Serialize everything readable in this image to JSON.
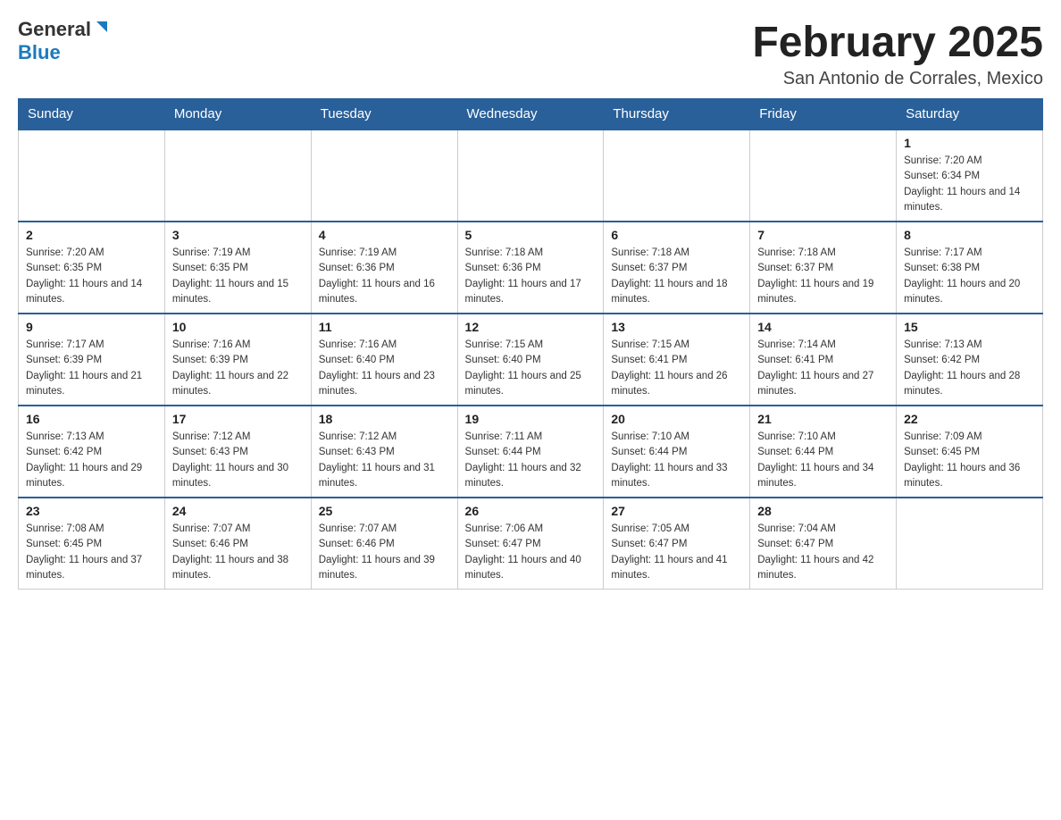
{
  "header": {
    "logo_general": "General",
    "logo_blue": "Blue",
    "title": "February 2025",
    "location": "San Antonio de Corrales, Mexico"
  },
  "weekdays": [
    "Sunday",
    "Monday",
    "Tuesday",
    "Wednesday",
    "Thursday",
    "Friday",
    "Saturday"
  ],
  "weeks": [
    [
      {
        "day": "",
        "info": ""
      },
      {
        "day": "",
        "info": ""
      },
      {
        "day": "",
        "info": ""
      },
      {
        "day": "",
        "info": ""
      },
      {
        "day": "",
        "info": ""
      },
      {
        "day": "",
        "info": ""
      },
      {
        "day": "1",
        "info": "Sunrise: 7:20 AM\nSunset: 6:34 PM\nDaylight: 11 hours and 14 minutes."
      }
    ],
    [
      {
        "day": "2",
        "info": "Sunrise: 7:20 AM\nSunset: 6:35 PM\nDaylight: 11 hours and 14 minutes."
      },
      {
        "day": "3",
        "info": "Sunrise: 7:19 AM\nSunset: 6:35 PM\nDaylight: 11 hours and 15 minutes."
      },
      {
        "day": "4",
        "info": "Sunrise: 7:19 AM\nSunset: 6:36 PM\nDaylight: 11 hours and 16 minutes."
      },
      {
        "day": "5",
        "info": "Sunrise: 7:18 AM\nSunset: 6:36 PM\nDaylight: 11 hours and 17 minutes."
      },
      {
        "day": "6",
        "info": "Sunrise: 7:18 AM\nSunset: 6:37 PM\nDaylight: 11 hours and 18 minutes."
      },
      {
        "day": "7",
        "info": "Sunrise: 7:18 AM\nSunset: 6:37 PM\nDaylight: 11 hours and 19 minutes."
      },
      {
        "day": "8",
        "info": "Sunrise: 7:17 AM\nSunset: 6:38 PM\nDaylight: 11 hours and 20 minutes."
      }
    ],
    [
      {
        "day": "9",
        "info": "Sunrise: 7:17 AM\nSunset: 6:39 PM\nDaylight: 11 hours and 21 minutes."
      },
      {
        "day": "10",
        "info": "Sunrise: 7:16 AM\nSunset: 6:39 PM\nDaylight: 11 hours and 22 minutes."
      },
      {
        "day": "11",
        "info": "Sunrise: 7:16 AM\nSunset: 6:40 PM\nDaylight: 11 hours and 23 minutes."
      },
      {
        "day": "12",
        "info": "Sunrise: 7:15 AM\nSunset: 6:40 PM\nDaylight: 11 hours and 25 minutes."
      },
      {
        "day": "13",
        "info": "Sunrise: 7:15 AM\nSunset: 6:41 PM\nDaylight: 11 hours and 26 minutes."
      },
      {
        "day": "14",
        "info": "Sunrise: 7:14 AM\nSunset: 6:41 PM\nDaylight: 11 hours and 27 minutes."
      },
      {
        "day": "15",
        "info": "Sunrise: 7:13 AM\nSunset: 6:42 PM\nDaylight: 11 hours and 28 minutes."
      }
    ],
    [
      {
        "day": "16",
        "info": "Sunrise: 7:13 AM\nSunset: 6:42 PM\nDaylight: 11 hours and 29 minutes."
      },
      {
        "day": "17",
        "info": "Sunrise: 7:12 AM\nSunset: 6:43 PM\nDaylight: 11 hours and 30 minutes."
      },
      {
        "day": "18",
        "info": "Sunrise: 7:12 AM\nSunset: 6:43 PM\nDaylight: 11 hours and 31 minutes."
      },
      {
        "day": "19",
        "info": "Sunrise: 7:11 AM\nSunset: 6:44 PM\nDaylight: 11 hours and 32 minutes."
      },
      {
        "day": "20",
        "info": "Sunrise: 7:10 AM\nSunset: 6:44 PM\nDaylight: 11 hours and 33 minutes."
      },
      {
        "day": "21",
        "info": "Sunrise: 7:10 AM\nSunset: 6:44 PM\nDaylight: 11 hours and 34 minutes."
      },
      {
        "day": "22",
        "info": "Sunrise: 7:09 AM\nSunset: 6:45 PM\nDaylight: 11 hours and 36 minutes."
      }
    ],
    [
      {
        "day": "23",
        "info": "Sunrise: 7:08 AM\nSunset: 6:45 PM\nDaylight: 11 hours and 37 minutes."
      },
      {
        "day": "24",
        "info": "Sunrise: 7:07 AM\nSunset: 6:46 PM\nDaylight: 11 hours and 38 minutes."
      },
      {
        "day": "25",
        "info": "Sunrise: 7:07 AM\nSunset: 6:46 PM\nDaylight: 11 hours and 39 minutes."
      },
      {
        "day": "26",
        "info": "Sunrise: 7:06 AM\nSunset: 6:47 PM\nDaylight: 11 hours and 40 minutes."
      },
      {
        "day": "27",
        "info": "Sunrise: 7:05 AM\nSunset: 6:47 PM\nDaylight: 11 hours and 41 minutes."
      },
      {
        "day": "28",
        "info": "Sunrise: 7:04 AM\nSunset: 6:47 PM\nDaylight: 11 hours and 42 minutes."
      },
      {
        "day": "",
        "info": ""
      }
    ]
  ]
}
